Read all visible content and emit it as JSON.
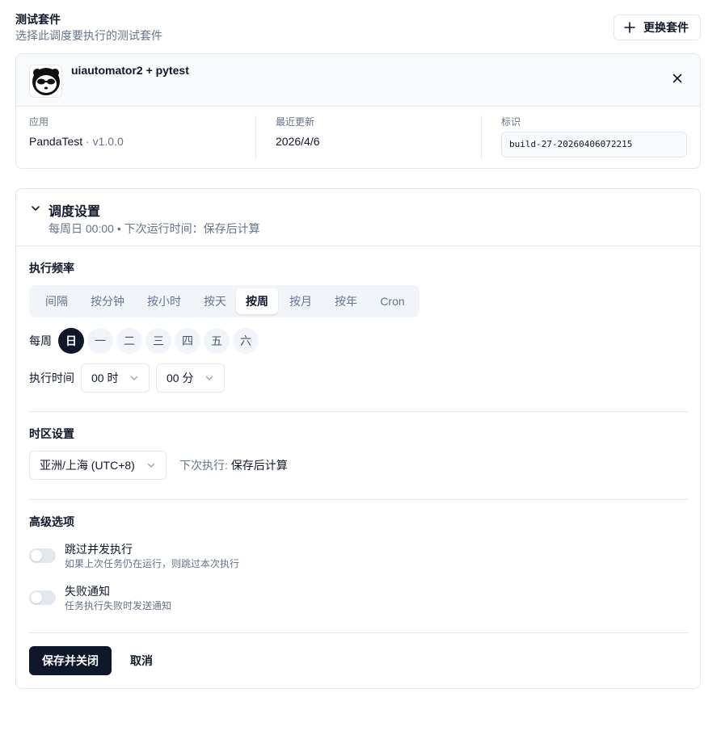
{
  "suite": {
    "title": "测试套件",
    "subtitle": "选择此调度要执行的测试套件",
    "change_button": "更换套件",
    "name": "uiautomator2 + pytest",
    "app_label": "应用",
    "app_name": "PandaTest",
    "app_version": " · v1.0.0",
    "updated_label": "最近更新",
    "updated_value": "2026/4/6",
    "ident_label": "标识",
    "ident_value": "build-27-20260406072215"
  },
  "schedule": {
    "title": "调度设置",
    "summary": "每周日 00:00 • 下次运行时间：保存后计算",
    "frequency_label": "执行频率",
    "frequency_tabs": [
      "间隔",
      "按分钟",
      "按小时",
      "按天",
      "按周",
      "按月",
      "按年",
      "Cron"
    ],
    "frequency_selected": "按周",
    "week_label": "每周",
    "days": [
      "日",
      "一",
      "二",
      "三",
      "四",
      "五",
      "六"
    ],
    "day_selected": "日",
    "time_label": "执行时间",
    "hour_value": "00 时",
    "minute_value": "00 分",
    "timezone_label": "时区设置",
    "timezone_value": "亚洲/上海 (UTC+8)",
    "next_run_label": "下次执行: ",
    "next_run_value": "保存后计算",
    "advanced_label": "高级选项",
    "skip_concurrent_title": "跳过并发执行",
    "skip_concurrent_desc": "如果上次任务仍在运行，则跳过本次执行",
    "skip_concurrent_on": false,
    "fail_notify_title": "失败通知",
    "fail_notify_desc": "任务执行失败时发送通知",
    "fail_notify_on": false,
    "save_button": "保存并关闭",
    "cancel_button": "取消"
  },
  "colors": {
    "primary": "#0f172a",
    "muted": "#64748b",
    "border": "#e2e8f0",
    "surface": "#f1f5f9"
  }
}
